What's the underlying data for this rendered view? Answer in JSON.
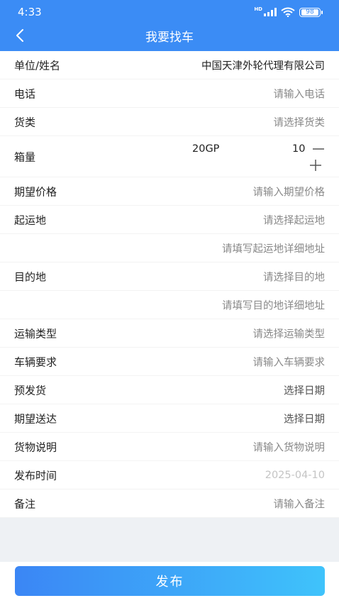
{
  "status_bar": {
    "time": "4:33",
    "network_label": "HD",
    "battery": "98"
  },
  "nav": {
    "back_icon": "chevron-left-icon",
    "title": "我要找车"
  },
  "form": {
    "company": {
      "label": "单位/姓名",
      "value": "中国天津外轮代理有限公司"
    },
    "phone": {
      "label": "电话",
      "placeholder": "请输入电话"
    },
    "cargo_type": {
      "label": "货类",
      "placeholder": "请选择货类"
    },
    "container": {
      "label": "箱量",
      "box_type": "20GP",
      "quantity": "10",
      "decrement_icon": "minus-icon",
      "increment_icon": "plus-icon"
    },
    "expected_price": {
      "label": "期望价格",
      "placeholder": "请输入期望价格"
    },
    "origin": {
      "label": "起运地",
      "placeholder": "请选择起运地",
      "detail_placeholder": "请填写起运地详细地址"
    },
    "destination": {
      "label": "目的地",
      "placeholder": "请选择目的地",
      "detail_placeholder": "请填写目的地详细地址"
    },
    "transport_type": {
      "label": "运输类型",
      "placeholder": "请选择运输类型"
    },
    "vehicle_requirement": {
      "label": "车辆要求",
      "placeholder": "请输入车辆要求"
    },
    "pickup_date": {
      "label": "预发货",
      "placeholder": "选择日期"
    },
    "delivery_date": {
      "label": "期望送达",
      "placeholder": "选择日期"
    },
    "cargo_description": {
      "label": "货物说明",
      "placeholder": "请输入货物说明"
    },
    "publish_time": {
      "label": "发布时间",
      "value": "2025-04-10"
    },
    "remarks": {
      "label": "备注",
      "placeholder": "请输入备注"
    }
  },
  "footer": {
    "publish_label": "发布"
  },
  "colors": {
    "brand": "#3b8cf5",
    "gradient_end": "#3fc3fb",
    "placeholder": "#888888",
    "muted": "#c4c4c4"
  }
}
